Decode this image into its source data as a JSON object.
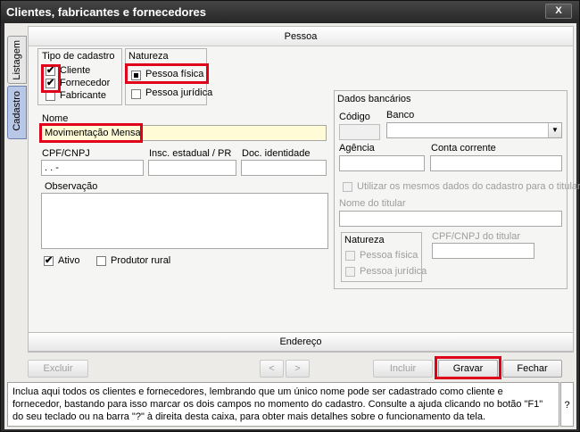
{
  "window": {
    "title": "Clientes, fabricantes e fornecedores",
    "close_label": "X"
  },
  "tabs": [
    {
      "label": "Listagem"
    },
    {
      "label": "Cadastro"
    }
  ],
  "pessoa_header": "Pessoa",
  "endereco_header": "Endereço",
  "tipo_cadastro": {
    "legend": "Tipo de cadastro",
    "items": [
      {
        "label": "Cliente",
        "checked": true
      },
      {
        "label": "Fornecedor",
        "checked": true
      },
      {
        "label": "Fabricante",
        "checked": false
      }
    ]
  },
  "natureza": {
    "legend": "Natureza",
    "items": [
      {
        "label": "Pessoa física",
        "selected": true
      },
      {
        "label": "Pessoa jurídica",
        "selected": false
      }
    ]
  },
  "nome": {
    "label": "Nome",
    "value": "Movimentação Mensal"
  },
  "cpf": {
    "label": "CPF/CNPJ",
    "value": ". . -"
  },
  "insc_estadual": {
    "label": "Insc. estadual / PR",
    "value": ""
  },
  "doc_identidade": {
    "label": "Doc. identidade",
    "value": ""
  },
  "observacao": {
    "label": "Observação",
    "value": ""
  },
  "ativo": {
    "label": "Ativo",
    "checked": true
  },
  "produtor_rural": {
    "label": "Produtor rural",
    "checked": false
  },
  "dados_bancarios": {
    "legend": "Dados bancários",
    "codigo_label": "Código",
    "banco_label": "Banco",
    "agencia_label": "Agência",
    "conta_label": "Conta corrente",
    "utilizar_label": "Utilizar os mesmos dados do cadastro para o titular",
    "nome_titular_label": "Nome do titular",
    "natureza_legend": "Natureza",
    "pessoa_fisica": "Pessoa física",
    "pessoa_juridica": "Pessoa jurídica",
    "cpf_titular_label": "CPF/CNPJ do titular"
  },
  "toolbar": {
    "excluir": "Excluir",
    "prev": "<",
    "next": ">",
    "incluir": "Incluir",
    "gravar": "Gravar",
    "fechar": "Fechar"
  },
  "help": {
    "text": "Inclua aqui todos os clientes e fornecedores, lembrando que um único nome pode ser cadastrado como cliente e fornecedor, bastando para isso marcar os dois campos no momento do cadastro. Consulte a ajuda clicando no botão \"F1\" do seu teclado ou na barra \"?\" à direita desta caixa, para obter mais detalhes sobre o funcionamento da tela.",
    "question_label": "?"
  },
  "colors": {
    "highlight": "#e0001a",
    "nome_field_bg": "#fefbd6",
    "active_tab": "#b8c7e6"
  }
}
